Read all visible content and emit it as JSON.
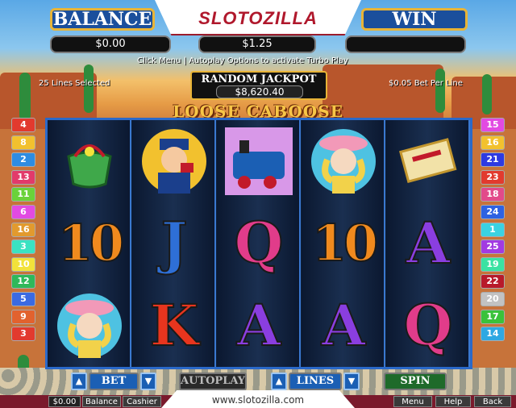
{
  "header": {
    "balance_label": "BALANCE",
    "balance_value": "$0.00",
    "bet_value": "$1.25",
    "win_label": "WIN",
    "win_value": "",
    "logo": "SLOTOZILLA"
  },
  "info": {
    "menu_hint": "Click Menu | Autoplay Options to activate Turbo Play",
    "lines_selected": "25 Lines Selected",
    "bet_per_line": "$0.05 Bet Per Line"
  },
  "jackpot": {
    "title": "RANDOM JACKPOT",
    "value": "$8,620.40"
  },
  "game_title": "LOOSE CABOOSE",
  "left_lines": [
    "4",
    "8",
    "2",
    "13",
    "11",
    "6",
    "16",
    "3",
    "10",
    "12",
    "5",
    "9",
    "3"
  ],
  "right_lines": [
    "15",
    "16",
    "21",
    "23",
    "18",
    "24",
    "1",
    "25",
    "19",
    "22",
    "20",
    "17",
    "14"
  ],
  "left_line_colors": [
    "#e23a2e",
    "#f2c12e",
    "#2e8ce2",
    "#e23a6a",
    "#6ad23a",
    "#e24ae2",
    "#e29a2e",
    "#3ae2c2",
    "#f2e23a",
    "#2eb85a",
    "#3a6ae2",
    "#e2622e",
    "#e23a2e"
  ],
  "right_line_colors": [
    "#e24ae2",
    "#f2c12e",
    "#2e3ae2",
    "#e23a2e",
    "#e24a8a",
    "#2e62e2",
    "#3ad2e2",
    "#a23ae2",
    "#3ae2a2",
    "#b81a2a",
    "#c2c2c2",
    "#3ac23a",
    "#2ea8e2"
  ],
  "reels": [
    [
      "purse-icon",
      "10",
      "lady-icon"
    ],
    [
      "conductor-icon",
      "J",
      "K"
    ],
    [
      "train-icon",
      "Q",
      "A"
    ],
    [
      "lady-icon",
      "10",
      "A"
    ],
    [
      "ticket-icon",
      "A",
      "Q"
    ]
  ],
  "controls": {
    "bet_label": "BET",
    "autoplay_label": "AUTOPLAY",
    "lines_label": "LINES",
    "spin_label": "SPIN",
    "up_arrow": "▲",
    "down_arrow": "▼"
  },
  "footer": {
    "url": "www.slotozilla.com",
    "balance_amount": "$0.00",
    "balance_label": "Balance",
    "cashier_label": "Cashier",
    "menu_label": "Menu",
    "help_label": "Help",
    "back_label": "Back"
  }
}
